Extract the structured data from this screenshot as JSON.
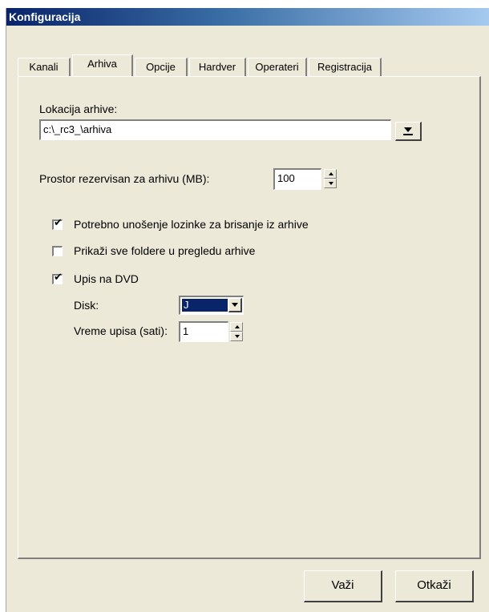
{
  "window": {
    "title": "Konfiguracija"
  },
  "tabs": [
    {
      "label": "Kanali"
    },
    {
      "label": "Arhiva"
    },
    {
      "label": "Opcije"
    },
    {
      "label": "Hardver"
    },
    {
      "label": "Operateri"
    },
    {
      "label": "Registracija"
    }
  ],
  "active_tab": "Arhiva",
  "archive": {
    "location_label": "Lokacija arhive:",
    "location_value": "c:\\_rc3_\\arhiva",
    "space_label": "Prostor rezervisan za arhivu (MB):",
    "space_value": "100"
  },
  "checkboxes": [
    {
      "label": "Potrebno unošenje lozinke za brisanje iz arhive",
      "checked": true
    },
    {
      "label": "Prikaži sve foldere u pregledu arhive",
      "checked": false
    },
    {
      "label": "Upis na DVD",
      "checked": true
    }
  ],
  "dvd": {
    "disk_label": "Disk:",
    "disk_value": "J",
    "time_label": "Vreme upisa (sati):",
    "time_value": "1"
  },
  "buttons": {
    "apply": "Važi",
    "cancel": "Otkaži"
  },
  "colors": {
    "title_bar_start": "#0a246a",
    "title_bar_end": "#a6caf0",
    "dialog_face": "#ece9d8",
    "selection": "#0a246a"
  }
}
